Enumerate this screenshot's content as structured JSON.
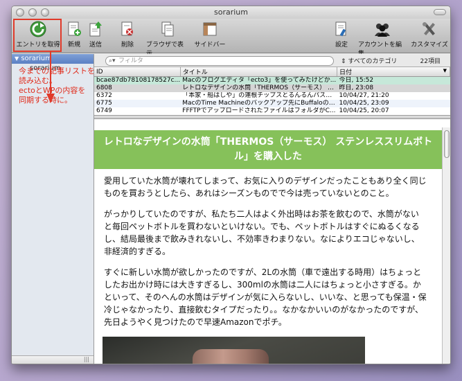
{
  "window": {
    "title": "sorarium"
  },
  "toolbar": {
    "fetch_label": "エントリを取得",
    "new_label": "新規",
    "send_label": "送信",
    "delete_label": "削除",
    "browser_label": "ブラウザで表示",
    "sidebar_label": "サイドバー",
    "settings_label": "設定",
    "accounts_label": "アカウントを編集",
    "customize_label": "カスタマイズ"
  },
  "sidebar": {
    "items": [
      {
        "label": "sorarium"
      },
      {
        "label": "sorarium"
      }
    ],
    "bottom_grip": "|||"
  },
  "annotation": {
    "lines": [
      "今までの記事リストを",
      "読み込む。",
      "ectoとWPの内容を",
      "同期する時に。"
    ]
  },
  "filter": {
    "placeholder": "フィルタ",
    "category": "すべてのカテゴリ",
    "count": "22項目"
  },
  "table": {
    "columns": [
      "ID",
      "タイトル",
      "日付"
    ],
    "rows": [
      {
        "id": "bcae87db78108178527c...",
        "title": "Macのブログエディタ「ecto3」を使ってみたけどか...",
        "date": "今日, 15:52"
      },
      {
        "id": "6808",
        "title": "レトロなデザインの水筒「THERMOS（サーモス） ス...",
        "date": "昨日, 23:08"
      },
      {
        "id": "6372",
        "title": "「本家・船はしや」の蓮根チップスとるんるんパスタ...",
        "date": "10/04/27, 21:20"
      },
      {
        "id": "6775",
        "title": "MacのTime Machineのバックアップ先にBuffaloのLi...",
        "date": "10/04/25, 23:09"
      },
      {
        "id": "6749",
        "title": "FFFTPでアップロードされたファイルはフォルダがC...",
        "date": "10/04/25, 20:07"
      }
    ]
  },
  "article": {
    "title": "レトロなデザインの水筒「THERMOS（サーモス） ステンレススリムボトル」を購入した",
    "paragraphs": [
      "愛用していた水筒が壊れてしまって、お気に入りのデザインだったこともあり全く同じものを買おうとしたら、あれはシーズンものでで今は売っていないとのこと。",
      "がっかりしていたのですが、私たち二人はよく外出時はお茶を飲むので、水筒がないと毎回ペットボトルを買わないといけない。でも、ペットボトルはすぐにぬるくなるし、結局最後まで飲みきれないし、不効率きわまりない。なによりエコじゃないし、非経済的すぎる。",
      "すぐに新しい水筒が欲しかったのですが、2Lの水筒（車で遠出する時用）はちょっとしたお出かけ時には大きすぎるし、300mlの水筒は二人にはちょっと小さすぎる。かといって、そのへんの水筒はデザインが気に入らないし、いいな、と思っても保温・保冷じゃなかったり、直接飲むタイプだったり。。なかなかいいのがなかったのですが、先日ようやく見つけたので早速Amazonでポチ。"
    ]
  },
  "colors": {
    "title_bar_green": "#86c15a",
    "annotation_red": "#e02a1a",
    "selected_row": "#c6e8d9"
  }
}
